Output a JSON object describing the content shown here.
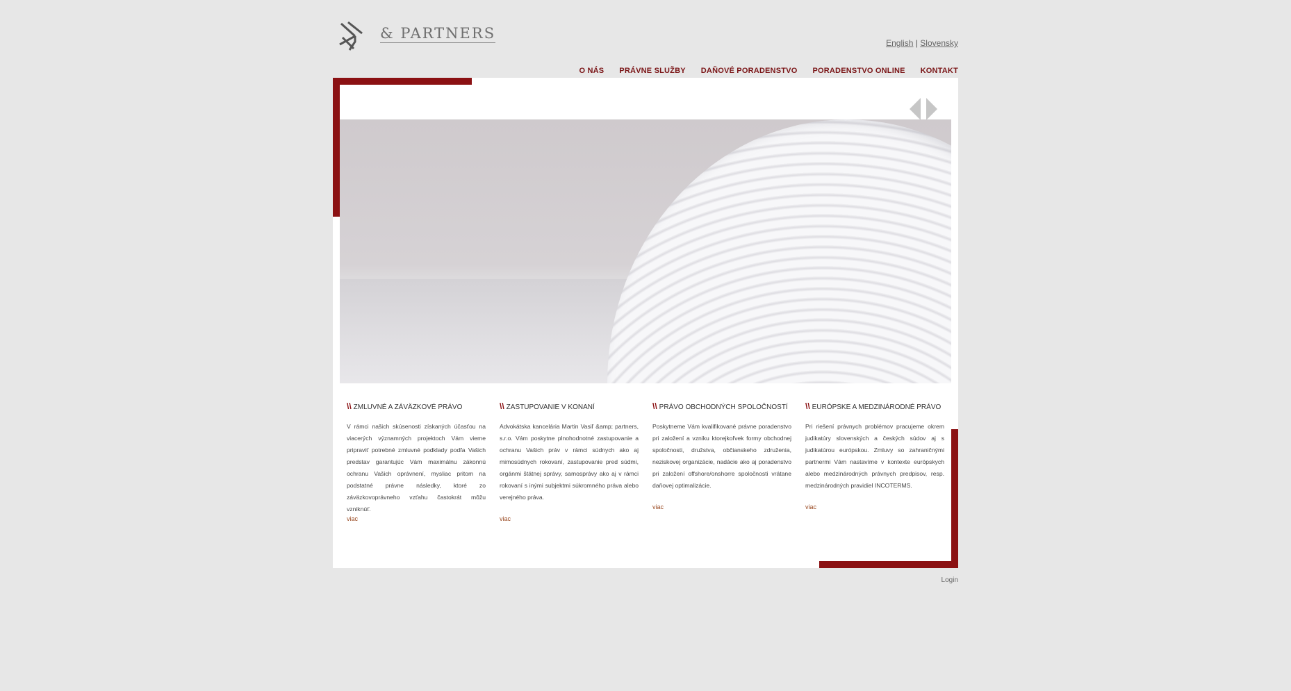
{
  "header": {
    "logo_text": "& PARTNERS",
    "logo_icon": "partners-logo-mark"
  },
  "languages": {
    "english": "English",
    "separator": "|",
    "slovak": "Slovensky"
  },
  "nav": {
    "items": [
      "O NÁS",
      "PRÁVNE SLUŽBY",
      "DAŇOVÉ PORADENSTVO",
      "PORADENSTVO ONLINE",
      "KONTAKT"
    ]
  },
  "colors": {
    "accent": "#8b1113",
    "nav_text": "#7a1416",
    "background": "#e7e7e7"
  },
  "slider": {
    "prev_icon": "left-arrow-icon",
    "next_icon": "right-arrow-icon"
  },
  "columns": [
    {
      "mark": "\\\\",
      "title": "ZMLUVNÉ A ZÁVÄZKOVÉ PRÁVO",
      "body": "V rámci našich skúsenosti získaných účasťou na viacerých významných projektoch Vám vieme pripraviť potrebné zmluvné podklady podľa Vašich predstav garantujúc Vám maximálnu zákonnú ochranu Vašich oprávnení, mysliac pritom na podstatné právne následky, ktoré zo záväzkovoprávneho vzťahu častokrát môžu vzniknúť.",
      "more": "viac"
    },
    {
      "mark": "\\\\",
      "title": "ZASTUPOVANIE V KONANÍ",
      "body": "Advokátska kancelária Martin Vasiľ &amp; partners, s.r.o. Vám poskytne plnohodnotné zastupovanie a ochranu Vašich práv v rámci súdnych ako aj mimosúdnych rokovaní, zastupovanie pred súdmi, orgánmi štátnej správy, samosprávy ako aj v rámci rokovaní s inými subjektmi súkromného práva alebo verejného práva.",
      "more": "viac"
    },
    {
      "mark": "\\\\",
      "title": "PRÁVO OBCHODNÝCH SPOLOČNOSTÍ",
      "body": "Poskytneme Vám kvalifikované právne poradenstvo pri založení a vzniku ktorejkoľvek formy obchodnej spoločnosti, družstva, občianskeho združenia, neziskovej organizácie, nadácie ako aj poradenstvo pri založení offshore/onshorre spoločnosti vrátane daňovej optimalizácie.",
      "more": "viac"
    },
    {
      "mark": "\\\\",
      "title": "EURÓPSKE A MEDZINÁRODNÉ PRÁVO",
      "body": "Pri riešení právnych problémov pracujeme okrem judikatúry slovenských a českých súdov aj s judikatúrou európskou. Zmluvy so zahraničnými partnermi Vám nastavíme v kontexte európskych alebo medzinárodných právnych predpisov, resp. medzinárodných pravidiel INCOTERMS.",
      "more": "viac"
    }
  ],
  "footer": {
    "login": "Login"
  }
}
